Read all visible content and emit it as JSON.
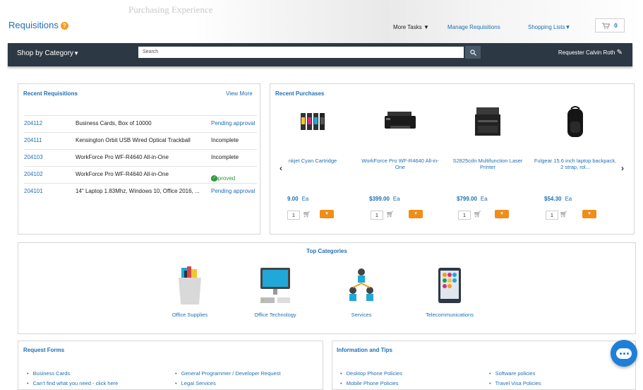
{
  "header": {
    "background_text": "Purchasing Experience",
    "title": "Requisitions",
    "help_glyph": "?",
    "more_tasks": "More Tasks",
    "manage_requisitions": "Manage Requisitions",
    "shopping_lists": "Shopping Lists",
    "cart_count": "0"
  },
  "navbar": {
    "shop_by_category": "Shop by Category",
    "search_placeholder": "Search",
    "requester_label": "Requester",
    "requester_name": "Calvin Roth"
  },
  "recent_requisitions": {
    "title": "Recent Requisitions",
    "view_more": "View More",
    "rows": [
      {
        "id": "204112",
        "description": "Business Cards, Box of 10000",
        "status": "Pending approval"
      },
      {
        "id": "204111",
        "description": "Kensington Orbit USB Wired Optical Trackball",
        "status": "Incomplete"
      },
      {
        "id": "204103",
        "description": "WorkForce Pro WF-R4640 All-in-One",
        "status": "Incomplete"
      },
      {
        "id": "204102",
        "description": "WorkForce Pro WF-R4640 All-in-One",
        "status": "Approved"
      },
      {
        "id": "204101",
        "description": "14\" Laptop 1.83Mhz, Windows 10, Office 2016, ...",
        "status": "Pending approval"
      }
    ]
  },
  "recent_purchases": {
    "title": "Recent Purchases",
    "unit": "Ea",
    "qty_default": "1",
    "items": [
      {
        "name": "nkjet Cyan Cartridge",
        "price": "9.00"
      },
      {
        "name": "WorkForce Pro WF-R4640 All-in-One",
        "price": "$399.00"
      },
      {
        "name": "S2825cdn Multifunction Laser Printer",
        "price": "$799.00"
      },
      {
        "name": "Fulgear 15.6 inch laptop backpack, 2 strap, rol...",
        "price": "$54.30"
      }
    ]
  },
  "top_categories": {
    "title": "Top Categories",
    "items": [
      {
        "label": "Office Supplies"
      },
      {
        "label": "Office Technology"
      },
      {
        "label": "Services"
      },
      {
        "label": "Telecommunications"
      }
    ]
  },
  "request_forms": {
    "title": "Request Forms",
    "col1": [
      "Business Cards",
      "Can't find what you need - click here"
    ],
    "col2": [
      "General Programmer / Developer Request",
      "Legal Services"
    ]
  },
  "info_tips": {
    "title": "Information and Tips",
    "col1": [
      "Desktop Phone Policies",
      "Mobile Phone Policies"
    ],
    "col2": [
      "Software policies",
      "Travel Visa Policies"
    ]
  },
  "colors": {
    "accent": "#1f6fb5",
    "navbar": "#2d3845",
    "orange": "#f08d1a",
    "approved": "#2d9a3d",
    "chat": "#1e7fd9"
  }
}
